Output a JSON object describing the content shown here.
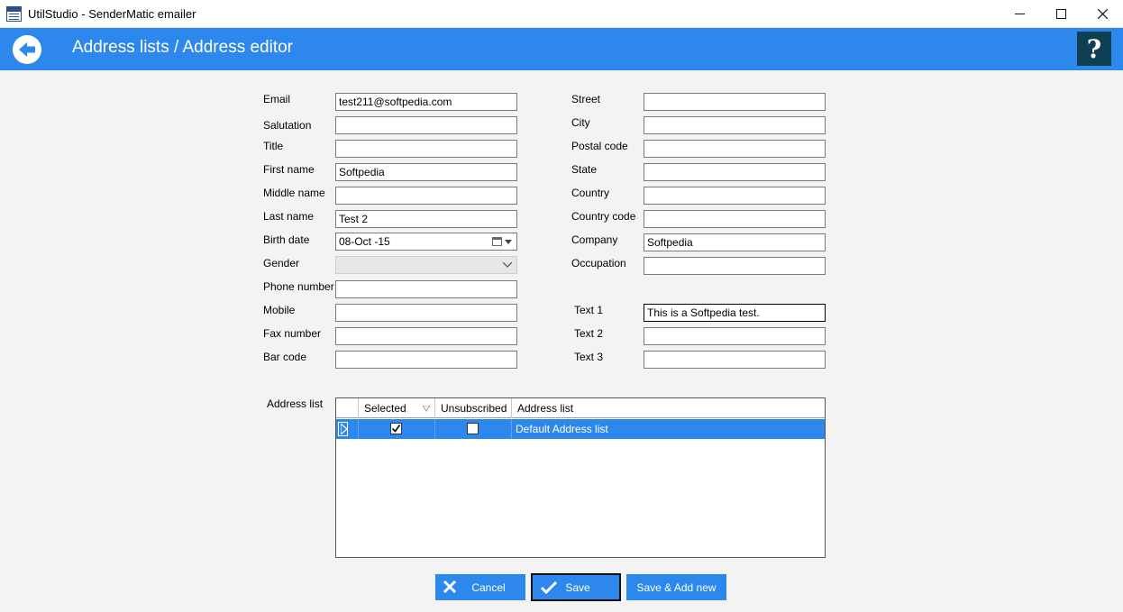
{
  "window": {
    "title": "UtilStudio - SenderMatic emailer",
    "minimize": "—",
    "maximize": "☐",
    "close": "✕"
  },
  "header": {
    "title": "Address lists / Address editor",
    "help": "?"
  },
  "form_left": [
    {
      "label": "Email",
      "value": "test211@softpedia.com"
    },
    {
      "label": "Salutation",
      "value": ""
    },
    {
      "label": "Title",
      "value": ""
    },
    {
      "label": "First name",
      "value": "Softpedia"
    },
    {
      "label": "Middle name",
      "value": ""
    },
    {
      "label": "Last name",
      "value": "Test 2"
    },
    {
      "label": "Birth date",
      "value": "08-Oct -15"
    },
    {
      "label": "Gender",
      "value": ""
    },
    {
      "label": "Phone number",
      "value": ""
    },
    {
      "label": "Mobile",
      "value": ""
    },
    {
      "label": "Fax number",
      "value": ""
    },
    {
      "label": "Bar code",
      "value": ""
    }
  ],
  "form_right": [
    {
      "label": "Street",
      "value": ""
    },
    {
      "label": "City",
      "value": ""
    },
    {
      "label": "Postal code",
      "value": ""
    },
    {
      "label": "State",
      "value": ""
    },
    {
      "label": "Country",
      "value": ""
    },
    {
      "label": "Country code",
      "value": ""
    },
    {
      "label": "Company",
      "value": "Softpedia"
    },
    {
      "label": "Occupation",
      "value": ""
    },
    {
      "label": "Text 1",
      "value": "This is a Softpedia test."
    },
    {
      "label": "Text 2",
      "value": ""
    },
    {
      "label": "Text 3",
      "value": ""
    }
  ],
  "address_list": {
    "label": "Address list",
    "columns": [
      "Selected",
      "Unsubscribed",
      "Address list"
    ],
    "rows": [
      {
        "selected": true,
        "unsubscribed": false,
        "name": "Default Address list"
      }
    ]
  },
  "buttons": {
    "cancel": "Cancel",
    "save": "Save",
    "save_add": "Save & Add new"
  },
  "colors": {
    "accent": "#2c88ec",
    "help_bg": "#0f3f52"
  }
}
